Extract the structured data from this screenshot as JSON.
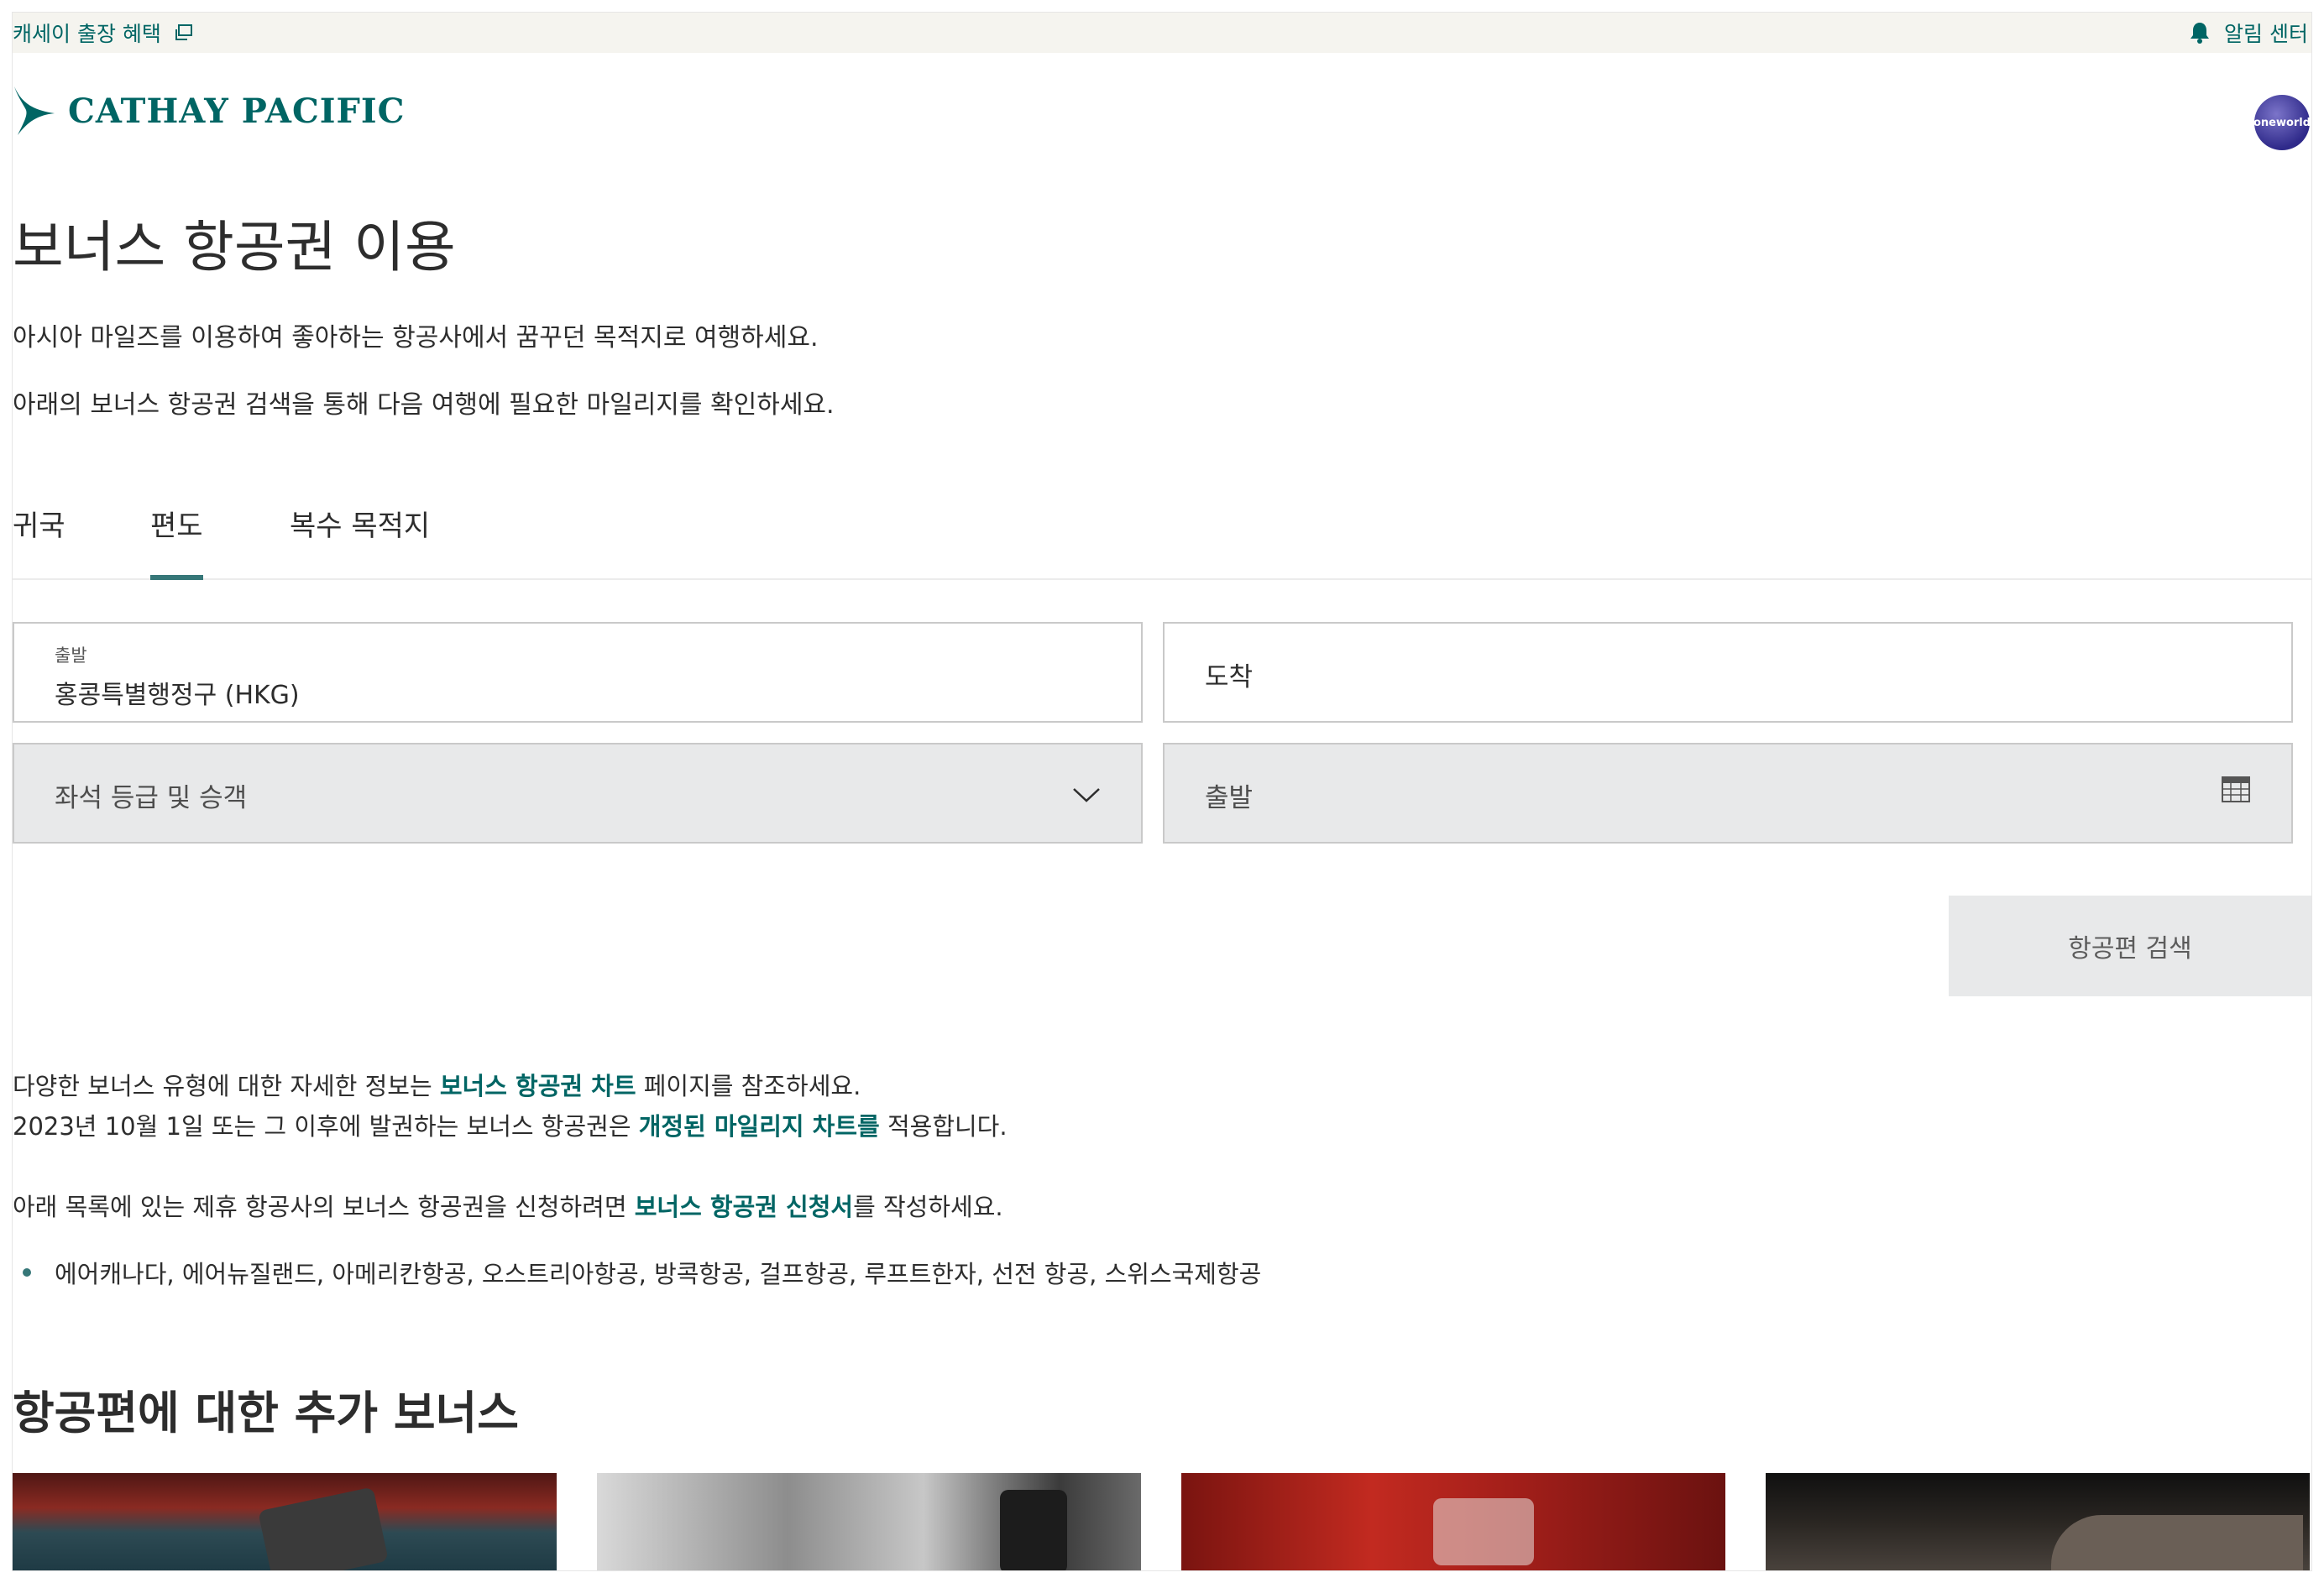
{
  "topbar": {
    "left_link": "캐세이 출장 혜택",
    "right_link": "알림 센터"
  },
  "brand": {
    "name": "CATHAY PACIFIC",
    "alliance": "oneworld",
    "color": "#006564"
  },
  "page": {
    "title": "보너스 항공권 이용",
    "intro_1": "아시아 마일즈를 이용하여 좋아하는 항공사에서 꿈꾸던 목적지로 여행하세요.",
    "intro_2": "아래의 보너스 항공권 검색을 통해 다음 여행에 필요한 마일리지를 확인하세요."
  },
  "tabs": [
    {
      "label": "귀국",
      "active": false
    },
    {
      "label": "편도",
      "active": true
    },
    {
      "label": "복수 목적지",
      "active": false
    }
  ],
  "form": {
    "origin_label": "출발",
    "origin_value": "홍콩특별행정구 (HKG)",
    "destination_placeholder": "도착",
    "cabin_placeholder": "좌석 등급 및 승객",
    "date_placeholder": "출발",
    "search_button": "항공편 검색"
  },
  "info": {
    "line1_pre": "다양한 보너스 유형에 대한 자세한 정보는 ",
    "line1_link": "보너스 항공권 차트",
    "line1_post": " 페이지를 참조하세요.",
    "line2_pre": "2023년 10월 1일 또는 그 이후에 발권하는 보너스 항공권은 ",
    "line2_link": "개정된 마일리지 차트를",
    "line2_post": " 적용합니다.",
    "line3_pre": "아래 목록에 있는 제휴 항공사의 보너스 항공권을 신청하려면 ",
    "line3_link": "보너스 항공권 신청서",
    "line3_post": "를 작성하세요.",
    "partners": "에어캐나다, 에어뉴질랜드, 아메리칸항공, 오스트리아항공, 방콕항공, 걸프항공, 루프트한자, 선전 항공, 스위스국제항공"
  },
  "section": {
    "title": "항공편에 대한 추가 보너스"
  }
}
